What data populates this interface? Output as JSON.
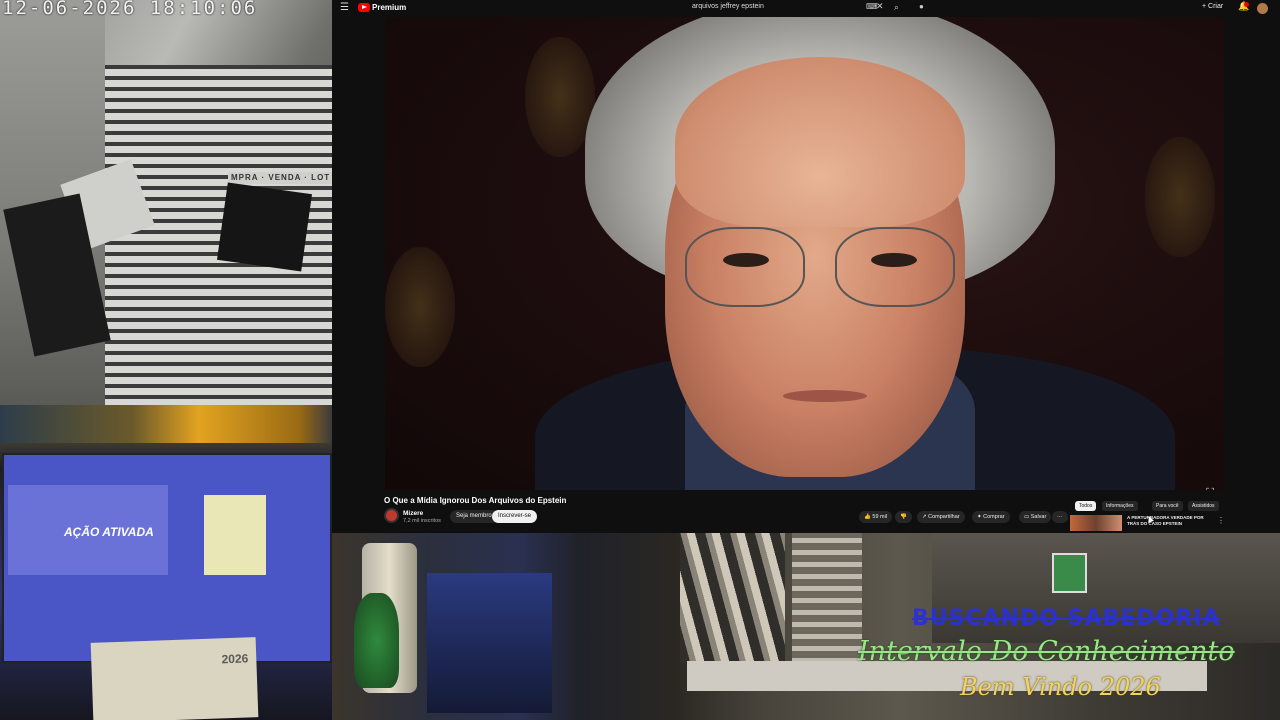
{
  "overlay": {
    "timestamp": "12-06-2026 18:10:06",
    "line1": "BUSCANDO SABEDORIA",
    "line2": "Intervalo Do Conhecimento",
    "line3": "Bem Vindo 2026"
  },
  "camera": {
    "shop_sign": "MPRA · VENDA · LOT",
    "monitor_banner": "AÇÃO ATIVADA",
    "calendar_year": "2026"
  },
  "youtube": {
    "brand": "Premium",
    "search_query": "arquivos jeffrey epstein",
    "create_label": "+ Criar",
    "video_title": "O Que a Mídia Ignorou Dos Arquivos do Epstein",
    "channel": {
      "name": "Mizere",
      "subscribers": "7,2 mil inscritos"
    },
    "join_label": "Seja membro",
    "subscribe_label": "Inscrever-se",
    "actions": {
      "likes": "59 mil",
      "share": "Compartilhar",
      "thanks": "Comprar",
      "save": "Salvar",
      "more": "···"
    },
    "chips": [
      "Todos",
      "Informações",
      "Para você",
      "Assistidos"
    ],
    "recommended_title": "A PERTURBADORA VERDADE POR TRÁS DO CASO EPSTEIN"
  },
  "colors": {
    "overlay_blue": "#2a30d8",
    "overlay_green": "#9be68a",
    "overlay_gold": "#f2d35c",
    "youtube_red": "#ff0000"
  }
}
